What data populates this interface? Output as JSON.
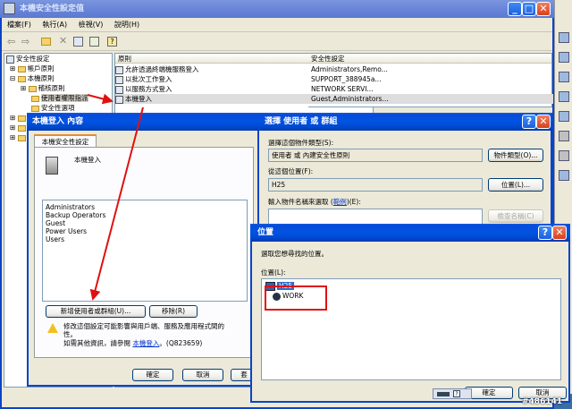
{
  "main_window": {
    "title": "本機安全性設定值",
    "menu": [
      "檔案(F)",
      "執行(A)",
      "檢視(V)",
      "說明(H)"
    ],
    "tree": [
      "安全性設定",
      "帳戶原則",
      "本機原則",
      "稽核原則",
      "使用者權限指派",
      "安全性選項"
    ],
    "columns": {
      "policy": "原則",
      "setting": "安全性設定"
    },
    "rows": [
      {
        "policy": "允許透過終端機服務登入",
        "setting": "Administrators,Remo..."
      },
      {
        "policy": "以批次工作登入",
        "setting": "SUPPORT_388945a..."
      },
      {
        "policy": "以服務方式登入",
        "setting": "NETWORK SERVI..."
      },
      {
        "policy": "本機登入",
        "setting": "Guest,Administrators..."
      }
    ]
  },
  "prop_dialog": {
    "title": "本機登入 內容",
    "tab": "本機安全性設定",
    "heading": "本機登入",
    "members": [
      "Administrators",
      "Backup Operators",
      "Guest",
      "Power Users",
      "Users"
    ],
    "add_button": "新增使用者或群組(U)...",
    "remove_button": "移除(R)",
    "warning_line1": "修改這個設定可能影響與用戶端、服務及應用程式間的",
    "warning_line2": "性。",
    "more_info_prefix": "如需其他資訊，請參閱",
    "more_info_link": "本機登入",
    "more_info_suffix": "。(Q823659)",
    "ok": "確定",
    "cancel": "取消",
    "apply": "套"
  },
  "select_dialog": {
    "title": "選擇 使用者 或 群組",
    "type_label": "選擇這個物件類型(S):",
    "type_value": "使用者 或 內建安全性原則",
    "type_button": "物件類型(O)...",
    "location_label": "從這個位置(F):",
    "location_value": "H25",
    "location_button": "位置(L)...",
    "names_label_prefix": "輸入物件名稱來選取 (",
    "names_link": "範例",
    "names_label_suffix": ")(E):",
    "check_button": "檢查名稱(C)"
  },
  "location_dialog": {
    "title": "位置",
    "prompt": "選取您想尋找的位置。",
    "list_label": "位置(L):",
    "items": [
      "H25",
      "WORK"
    ],
    "ok": "確定",
    "cancel": "取消"
  },
  "watermark": "#486141"
}
